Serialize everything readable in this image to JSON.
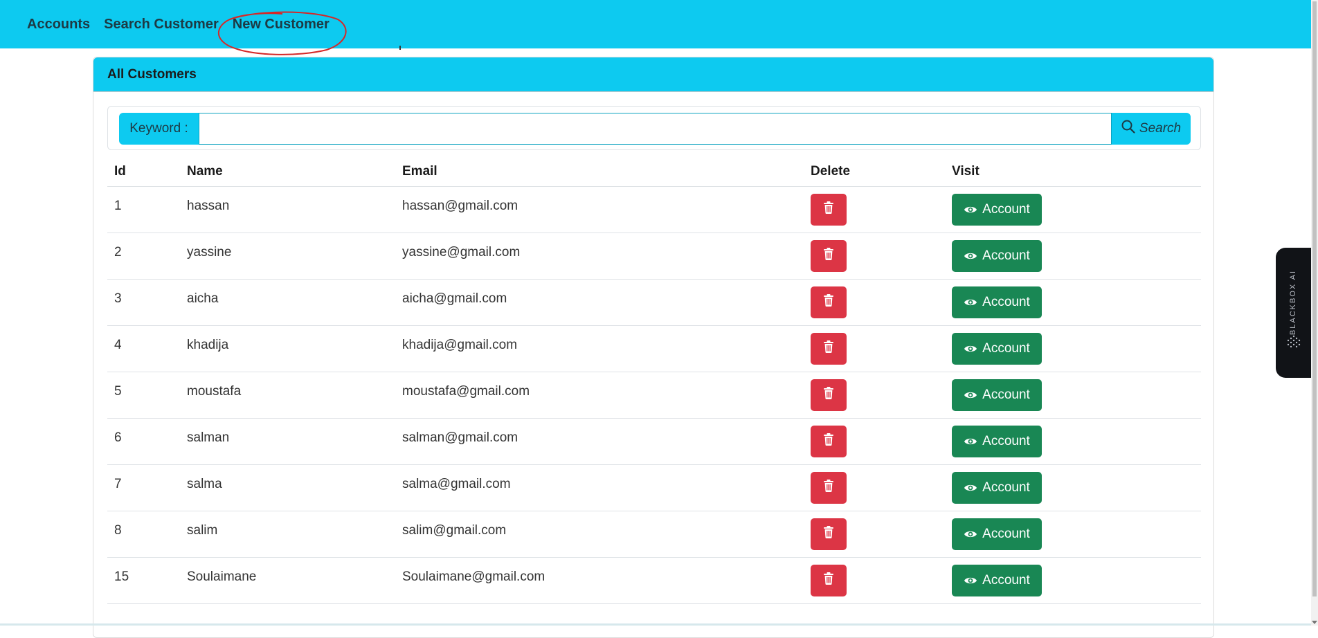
{
  "nav": {
    "items": [
      {
        "label": "Accounts"
      },
      {
        "label": "Search Customer"
      },
      {
        "label": "New Customer"
      }
    ]
  },
  "card": {
    "title": "All Customers"
  },
  "search": {
    "keyword_label": "Keyword :",
    "input_value": "",
    "button_label": "Search"
  },
  "table": {
    "headers": {
      "id": "Id",
      "name": "Name",
      "email": "Email",
      "delete": "Delete",
      "visit": "Visit"
    },
    "account_button_label": "Account",
    "rows": [
      {
        "id": "1",
        "name": "hassan",
        "email": "hassan@gmail.com"
      },
      {
        "id": "2",
        "name": "yassine",
        "email": "yassine@gmail.com"
      },
      {
        "id": "3",
        "name": "aicha",
        "email": "aicha@gmail.com"
      },
      {
        "id": "4",
        "name": "khadija",
        "email": "khadija@gmail.com"
      },
      {
        "id": "5",
        "name": "moustafa",
        "email": "moustafa@gmail.com"
      },
      {
        "id": "6",
        "name": "salman",
        "email": "salman@gmail.com"
      },
      {
        "id": "7",
        "name": "salma",
        "email": "salma@gmail.com"
      },
      {
        "id": "8",
        "name": "salim",
        "email": "salim@gmail.com"
      },
      {
        "id": "15",
        "name": "Soulaimane",
        "email": "Soulaimane@gmail.com"
      }
    ]
  },
  "side_widget": {
    "label": "BLACKBOX AI"
  },
  "colors": {
    "navbar": "#0dcaf0",
    "delete_button": "#dc3545",
    "account_button": "#198754",
    "annotation": "#d62828"
  },
  "icons": {
    "search": "search-icon",
    "delete": "trash-icon",
    "account": "eye-icon"
  }
}
